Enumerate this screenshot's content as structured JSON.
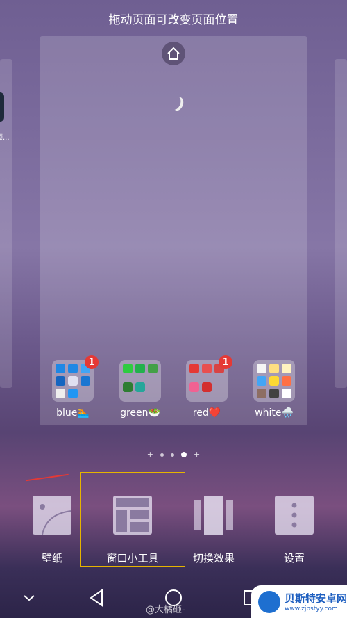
{
  "header": {
    "title": "拖动页面可改变页面位置"
  },
  "left_page": {
    "app_label": "频..."
  },
  "folders": [
    {
      "label": "blue🏊",
      "badge": "1",
      "colors": [
        "#1e88e5",
        "#1e88e5",
        "#42a5f5",
        "#1565c0",
        "#e0e0f0",
        "#1976d2",
        "#eeeeee",
        "#2196f3"
      ]
    },
    {
      "label": "green🥗",
      "badge": "",
      "colors": [
        "#2ecc40",
        "#22b14c",
        "#43a047",
        "#2e7d32",
        "#26a69a"
      ]
    },
    {
      "label": "red❤️",
      "badge": "1",
      "colors": [
        "#e53935",
        "#e84f4f",
        "#d84343",
        "#f06292",
        "#d32f2f"
      ]
    },
    {
      "label": "white🌧️",
      "badge": "",
      "colors": [
        "#f5f5f5",
        "#ffe082",
        "#fff3c0",
        "#42a5f5",
        "#fdd835",
        "#ff7043",
        "#8d6e63",
        "#424242",
        "#ffffff"
      ]
    }
  ],
  "page_indicator": {
    "count": 3,
    "active": 3
  },
  "tools": [
    {
      "label": "壁纸",
      "icon": "wallpaper-icon"
    },
    {
      "label": "窗口小工具",
      "icon": "widgets-icon"
    },
    {
      "label": "切换效果",
      "icon": "transition-effect-icon"
    },
    {
      "label": "设置",
      "icon": "settings-icon"
    }
  ],
  "watermark": {
    "weibo": "@大橘砸-",
    "site_name": "贝斯特安卓网",
    "site_url": "www.zjbstyy.com"
  },
  "colors": {
    "highlight": "#e6b400",
    "arrow": "#e53935",
    "badge": "#e53935"
  }
}
